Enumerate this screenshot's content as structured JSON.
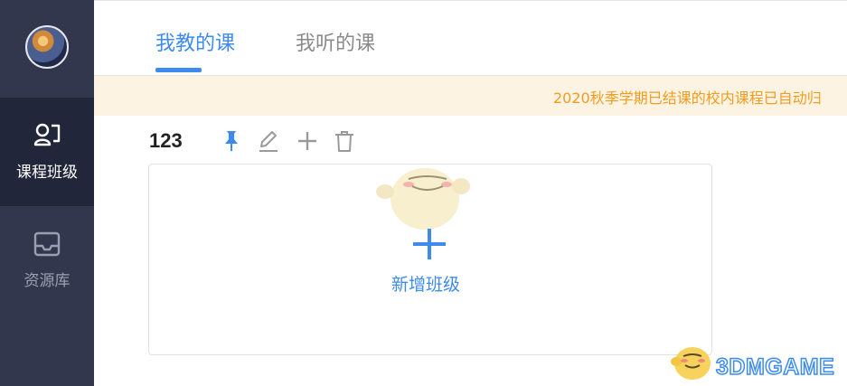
{
  "sidebar": {
    "items": [
      {
        "label": "课程班级",
        "icon": "course-icon",
        "active": true
      },
      {
        "label": "资源库",
        "icon": "inbox-icon",
        "active": false
      }
    ]
  },
  "tabs": [
    {
      "label": "我教的课",
      "active": true
    },
    {
      "label": "我听的课",
      "active": false
    }
  ],
  "notice": {
    "text": "2020秋季学期已结课的校内课程已自动归"
  },
  "class_card": {
    "name": "123",
    "tools": [
      "pin-icon",
      "edit-icon",
      "add-icon",
      "delete-icon"
    ],
    "add_label": "新增班级"
  },
  "watermark": {
    "text": "3DMGAME"
  },
  "colors": {
    "accent": "#3d8bef",
    "sidebar": "#33374d",
    "sidebar_active": "#22263a",
    "notice_bg": "#fdf3e3",
    "notice_text": "#f39c1f"
  }
}
